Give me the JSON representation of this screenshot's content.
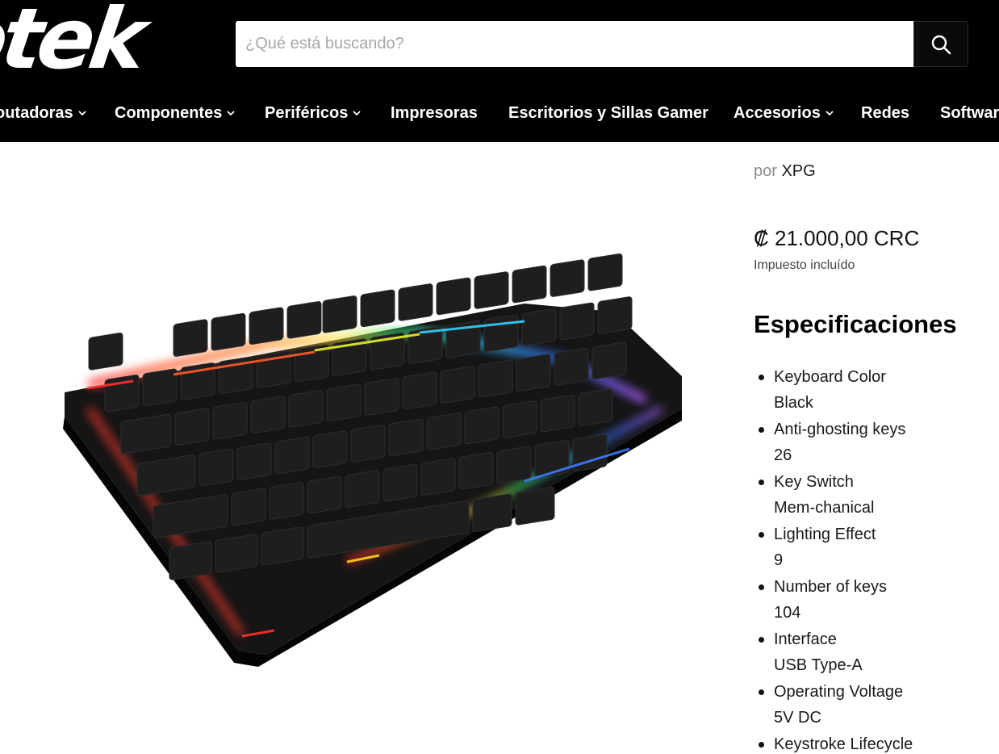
{
  "header": {
    "logo_text": "otek",
    "search": {
      "placeholder": "¿Qué está buscando?",
      "value": ""
    }
  },
  "nav": {
    "items": [
      {
        "label": "outadoras",
        "has_dropdown": true
      },
      {
        "label": "Componentes",
        "has_dropdown": true
      },
      {
        "label": "Periféricos",
        "has_dropdown": true
      },
      {
        "label": "Impresoras",
        "has_dropdown": false
      },
      {
        "label": "Escritorios y Sillas Gamer",
        "has_dropdown": false
      },
      {
        "label": "Accesorios",
        "has_dropdown": true
      },
      {
        "label": "Redes",
        "has_dropdown": false
      },
      {
        "label": "Softwar",
        "has_dropdown": false
      }
    ]
  },
  "product": {
    "vendor_prefix": "por",
    "vendor": "XPG",
    "price": "₡ 21.000,00 CRC",
    "tax_note": "Impuesto incluído",
    "specs_title": "Especificaciones",
    "specs": [
      {
        "name": "Keyboard Color",
        "value": "Black"
      },
      {
        "name": "Anti-ghosting keys",
        "value": "26"
      },
      {
        "name": "Key Switch",
        "value": "Mem-chanical"
      },
      {
        "name": "Lighting Effect",
        "value": "9"
      },
      {
        "name": "Number of keys",
        "value": "104"
      },
      {
        "name": "Interface",
        "value": "USB Type-A"
      },
      {
        "name": "Operating Voltage",
        "value": "5V DC"
      },
      {
        "name": "Keystroke Lifecycle",
        "value": ""
      }
    ]
  },
  "colors": {
    "header_bg": "#000000",
    "nav_text": "#ffffff",
    "page_bg": "#ffffff"
  }
}
